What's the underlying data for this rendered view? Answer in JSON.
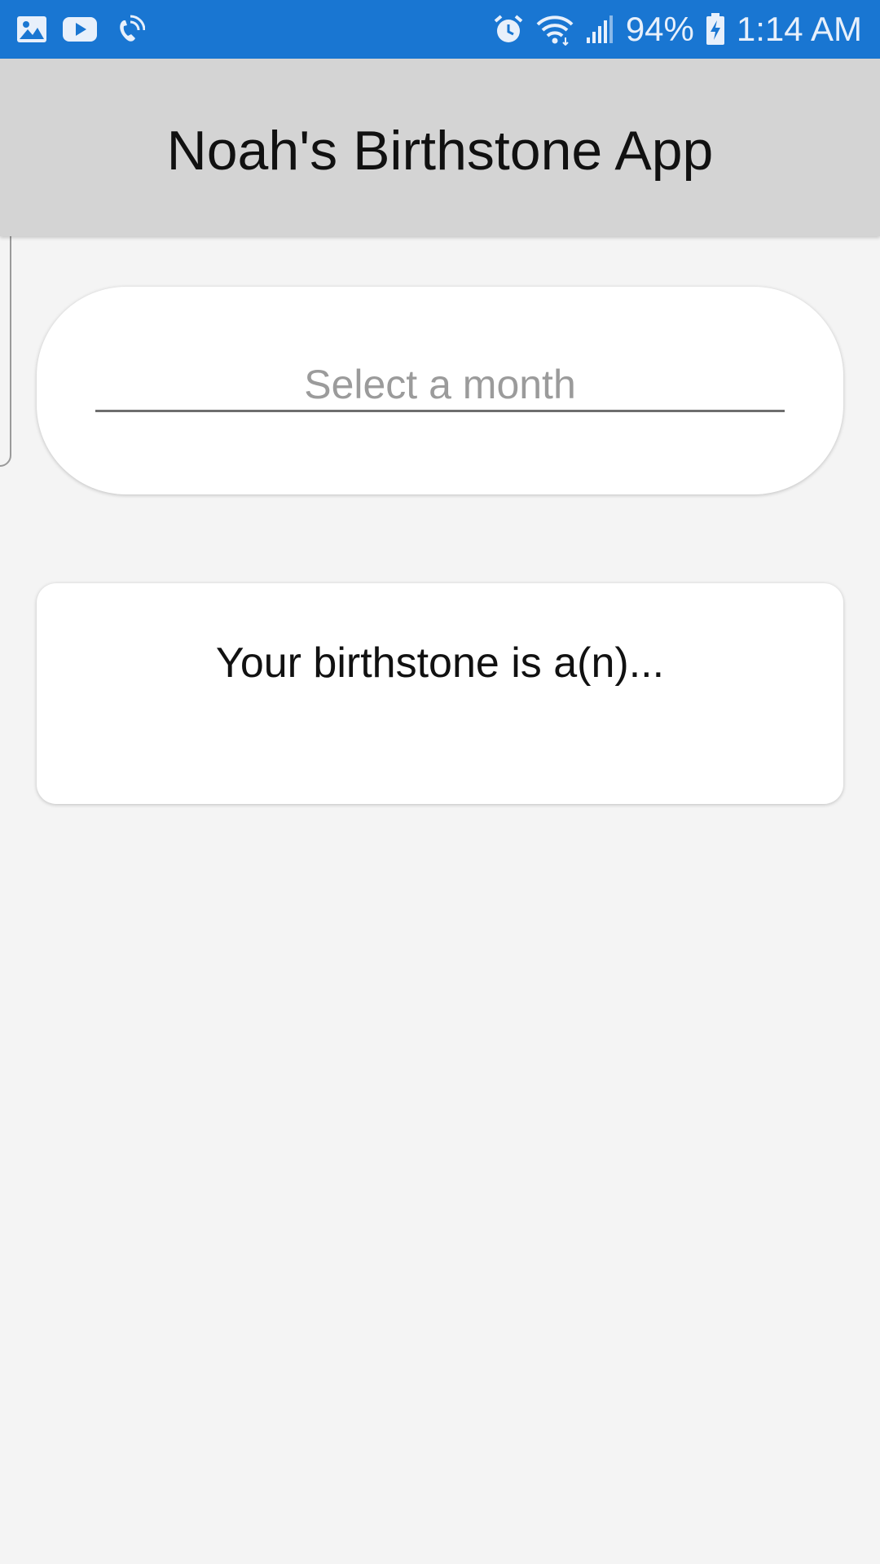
{
  "status_bar": {
    "battery": "94%",
    "time": "1:14 AM",
    "icons_left": [
      "gallery-icon",
      "youtube-icon",
      "wifi-call-icon"
    ],
    "icons_right": [
      "alarm-icon",
      "wifi-icon",
      "signal-icon",
      "battery-charging-icon"
    ],
    "background": "#1976d2"
  },
  "app_bar": {
    "title": "Noah's Birthstone App",
    "background": "#d4d4d4"
  },
  "picker": {
    "placeholder": "Select a month"
  },
  "result": {
    "text": "Your birthstone is a(n)..."
  }
}
